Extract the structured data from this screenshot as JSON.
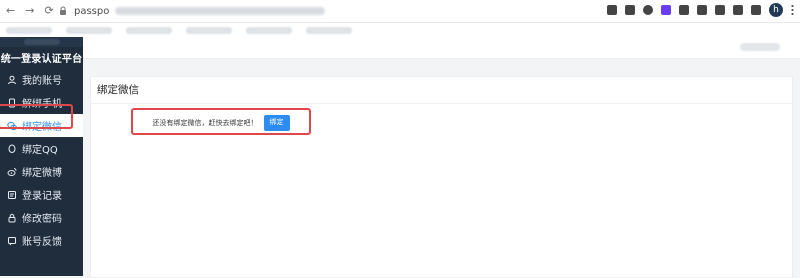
{
  "browser": {
    "url_prefix": "passpo",
    "avatar_initial": "h"
  },
  "sidebar": {
    "brand": "统一登录认证平台",
    "items": [
      {
        "label": "我的账号",
        "icon": "user-icon"
      },
      {
        "label": "解绑手机",
        "icon": "phone-icon"
      },
      {
        "label": "绑定微信",
        "icon": "wechat-icon",
        "active": true
      },
      {
        "label": "绑定QQ",
        "icon": "qq-icon"
      },
      {
        "label": "绑定微博",
        "icon": "weibo-icon"
      },
      {
        "label": "登录记录",
        "icon": "record-icon"
      },
      {
        "label": "修改密码",
        "icon": "lock-icon"
      },
      {
        "label": "账号反馈",
        "icon": "feedback-icon"
      }
    ]
  },
  "main": {
    "panel_title": "绑定微信",
    "notice_text": "还没有绑定微信，赶快去绑定吧！",
    "bind_button": "绑定"
  },
  "colors": {
    "sidebar_bg": "#1f2d3d",
    "accent": "#2d8cf0",
    "highlight": "#e0474a"
  }
}
